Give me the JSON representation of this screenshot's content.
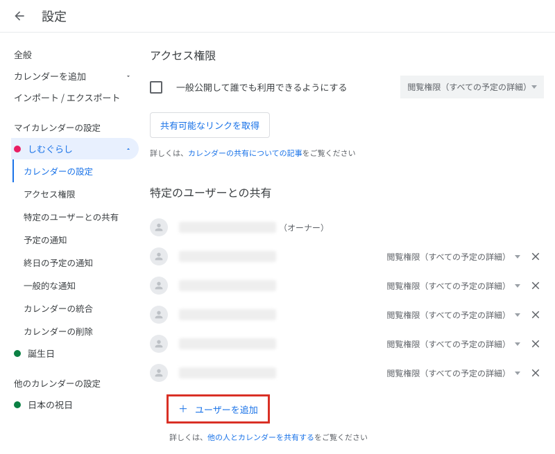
{
  "header": {
    "title": "設定"
  },
  "sidebar": {
    "general": "全般",
    "add_calendar": "カレンダーを追加",
    "import_export": "インポート / エクスポート",
    "my_cal_section": "マイカレンダーの設定",
    "active_cal": "しむぐらし",
    "sub": {
      "cal_settings": "カレンダーの設定",
      "access": "アクセス権限",
      "specific_users": "特定のユーザーとの共有",
      "event_notif": "予定の通知",
      "allday_notif": "終日の予定の通知",
      "general_notif": "一般的な通知",
      "integrate": "カレンダーの統合",
      "delete": "カレンダーの削除"
    },
    "birthday": "誕生日",
    "other_cal_section": "他のカレンダーの設定",
    "jp_holidays": "日本の祝日"
  },
  "access_section": {
    "heading": "アクセス権限",
    "public_checkbox_label": "一般公開して誰でも利用できるようにする",
    "perm_default": "閲覧権限（すべての予定の詳細）",
    "get_link_btn": "共有可能なリンクを取得",
    "help_prefix": "詳しくは、",
    "help_link": "カレンダーの共有についての記事",
    "help_suffix": "をご覧ください"
  },
  "share_section": {
    "heading": "特定のユーザーとの共有",
    "owner_tag": "（オーナー）",
    "perm_label": "閲覧権限（すべての予定の詳細）",
    "add_user_btn": "ユーザーを追加",
    "help_prefix": "詳しくは、",
    "help_link": "他の人とカレンダーを共有する",
    "help_suffix": "をご覧ください"
  }
}
